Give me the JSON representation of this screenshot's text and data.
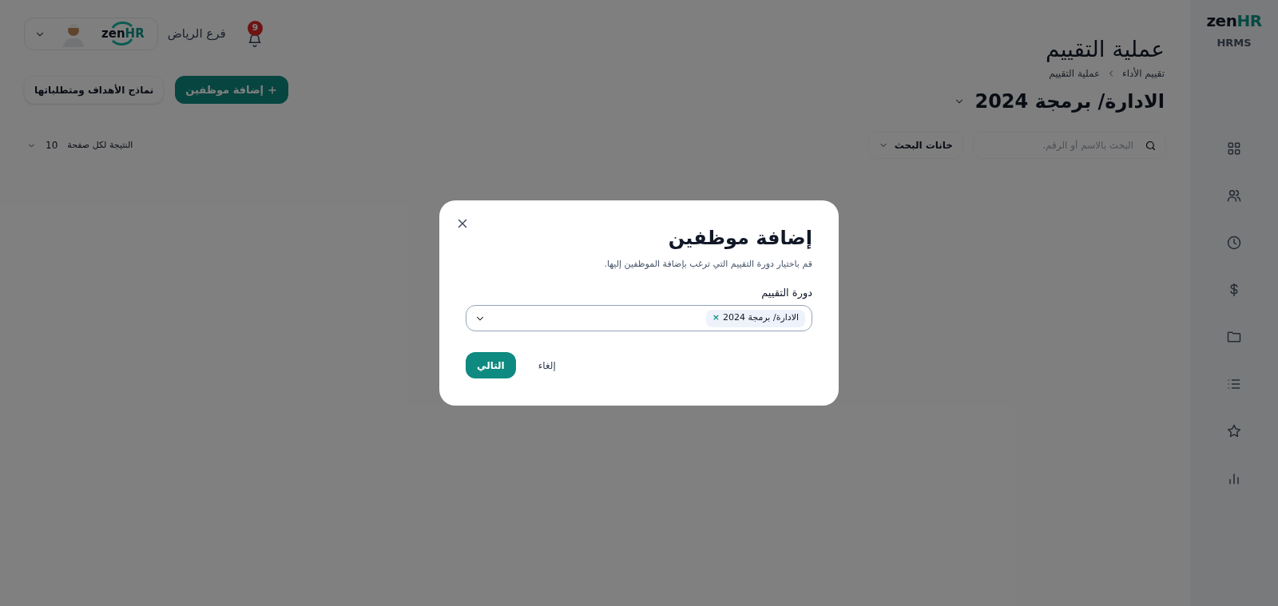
{
  "sidebar": {
    "logo": {
      "word": "zen",
      "accent": "HR",
      "subtitle": "HRMS"
    }
  },
  "header": {
    "title": "عملية التقييم",
    "breadcrumbs": [
      "تقييم الأداء",
      "عملية التقييم"
    ],
    "cycle": "الادارة/ برمجة 2024",
    "notifications": "9",
    "branch": "فرع الرياض",
    "company_logo": {
      "word": "zen",
      "accent": "HR"
    }
  },
  "actions": [
    {
      "kind": "primary",
      "label": "إضافة موظفين"
    },
    {
      "kind": "secondary",
      "label": "نماذج الأهداف ومتطلباتها"
    }
  ],
  "search": {
    "placeholder": "البحث بالاسم أو الرقم.",
    "fields_button": "خانات البحث"
  },
  "pagination": {
    "label": "النتيجة لكل صفحة",
    "value": "10"
  },
  "dialog": {
    "title": "إضافة موظفين",
    "description": "قم باختيار دورة التقييم التي ترغب بإضافة الموظفين إليها.",
    "field_label": "دورة التقييم",
    "chips": [
      {
        "label": "الادارة/ برمجة 2024",
        "remove": "×"
      }
    ],
    "buttons": [
      {
        "kind": "link",
        "label": "إلغاء"
      },
      {
        "kind": "primary",
        "label": "التالي"
      }
    ]
  }
}
